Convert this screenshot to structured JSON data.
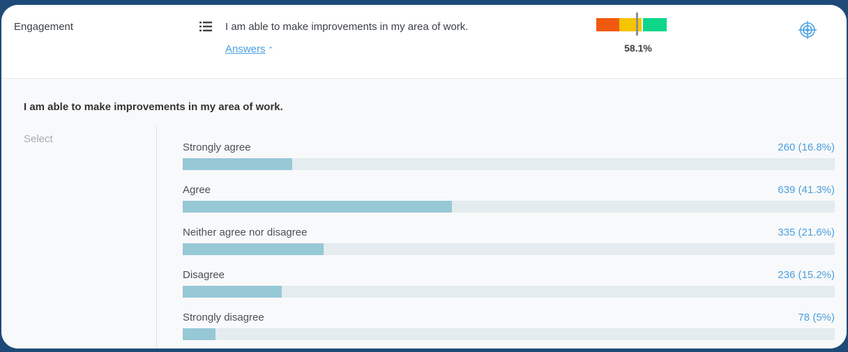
{
  "header": {
    "category": "Engagement",
    "question": "I am able to make improvements in my area of work.",
    "answers_link": "Answers",
    "score": "58.1%",
    "score_value": 58.1,
    "gauge_colors": [
      "#f05a0f",
      "#f7c400",
      "#0dd68a"
    ]
  },
  "panel": {
    "title": "I am able to make improvements in my area of work.",
    "select_label": "Select",
    "answers": [
      {
        "label": "Strongly agree",
        "value": "260 (16.8%)",
        "percent": 16.8
      },
      {
        "label": "Agree",
        "value": "639 (41.3%)",
        "percent": 41.3
      },
      {
        "label": "Neither agree nor disagree",
        "value": "335 (21.6%)",
        "percent": 21.6
      },
      {
        "label": "Disagree",
        "value": "236 (15.2%)",
        "percent": 15.2
      },
      {
        "label": "Strongly disagree",
        "value": "78 (5%)",
        "percent": 5
      }
    ]
  },
  "colors": {
    "accent": "#4a9fe0",
    "bar_fill": "#96c8d6",
    "bar_track": "#e4ecef",
    "background": "#1d4a78"
  }
}
